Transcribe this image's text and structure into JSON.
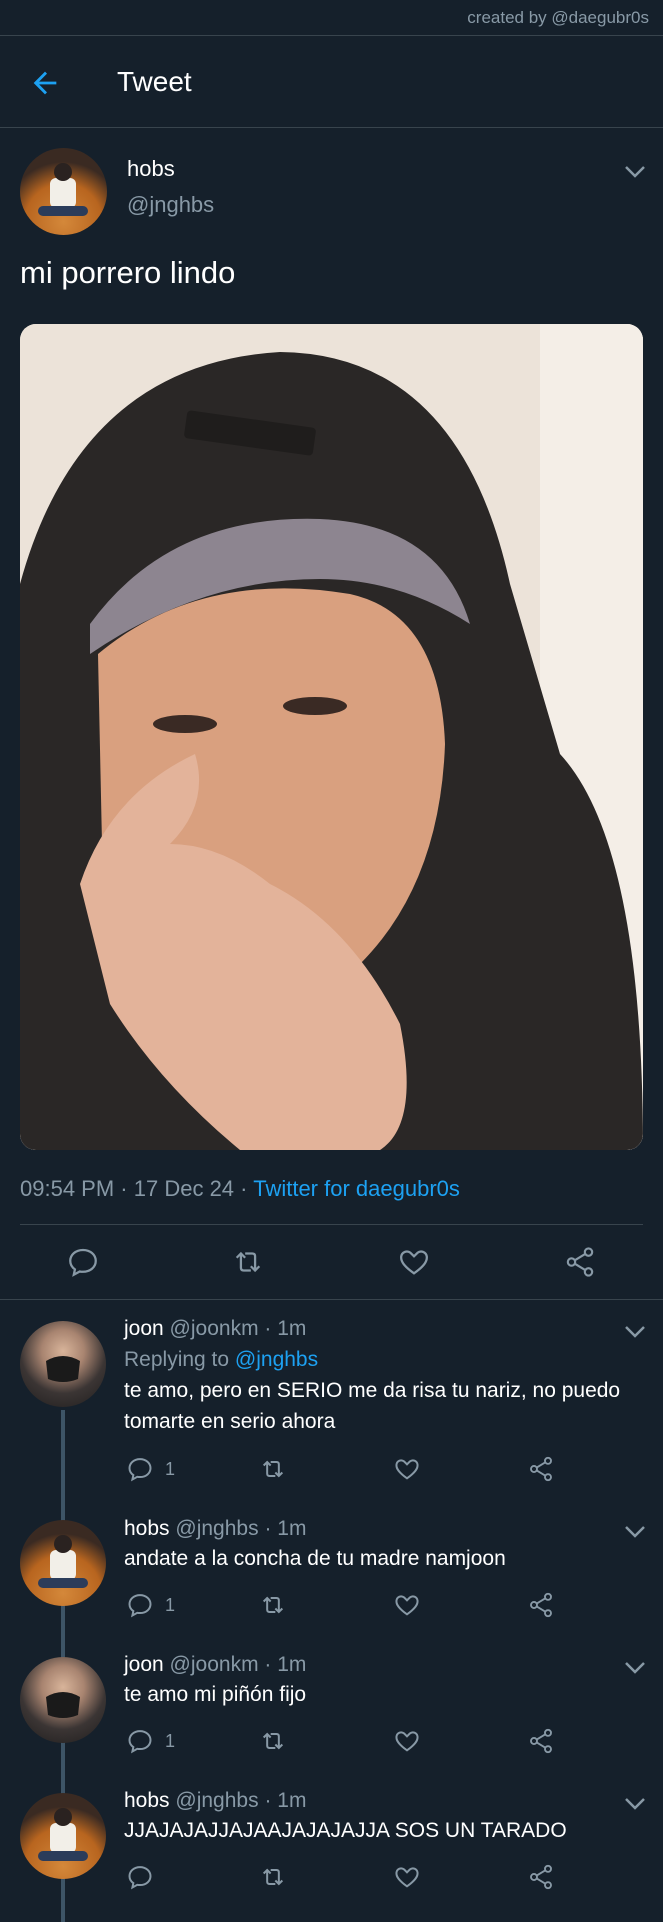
{
  "credit": "created by @daegubr0s",
  "header": {
    "title": "Tweet"
  },
  "tweet": {
    "name": "hobs",
    "handle": "@jnghbs",
    "text": "mi porrero lindo",
    "time": "09:54 PM",
    "date": "17 Dec 24",
    "source": "Twitter for daegubr0s"
  },
  "replies": [
    {
      "name": "joon",
      "handle": "@joonkm",
      "time": "1m",
      "replying_label": "Replying to",
      "replying_to": "@jnghbs",
      "text": "te amo, pero en SERIO me da risa tu nariz, no puedo tomarte en serio ahora",
      "reply_count": "1"
    },
    {
      "name": "hobs",
      "handle": "@jnghbs",
      "time": "1m",
      "text": "andate a la concha de tu madre namjoon",
      "reply_count": "1"
    },
    {
      "name": "joon",
      "handle": "@joonkm",
      "time": "1m",
      "text": "te amo mi piñón fijo",
      "reply_count": "1"
    },
    {
      "name": "hobs",
      "handle": "@jnghbs",
      "time": "1m",
      "text": "JJAJAJAJJAJAAJAJAJAJJA SOS UN TARADO",
      "reply_count": ""
    }
  ],
  "colors": {
    "background": "#15202b",
    "accent": "#1da1f2",
    "muted": "#8899a6",
    "divider": "#38444d"
  },
  "icons": [
    "back-arrow-icon",
    "chevron-down-icon",
    "reply-icon",
    "retweet-icon",
    "like-icon",
    "share-icon"
  ]
}
